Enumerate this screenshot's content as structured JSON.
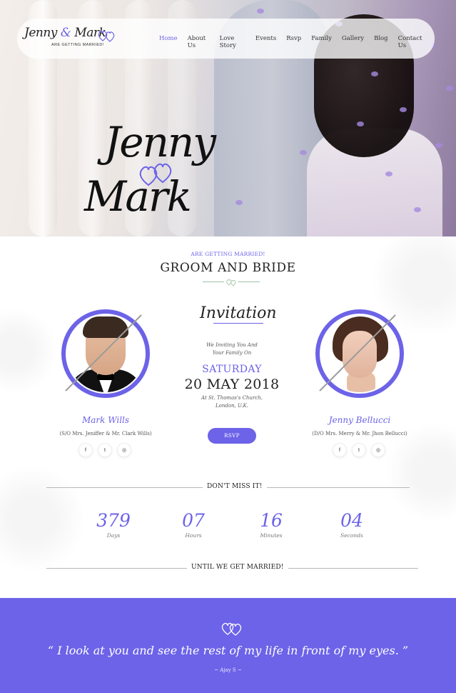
{
  "brand": {
    "logo_names_1": "Jenny ",
    "logo_amp": "&",
    "logo_names_2": " Mark",
    "logo_sub": "ARE GETTING MARRIED!"
  },
  "nav": {
    "items": [
      "Home",
      "About Us",
      "Love Story",
      "Events",
      "Rsvp",
      "Family",
      "Gallery",
      "Blog",
      "Contact Us"
    ],
    "active": "Home"
  },
  "hero": {
    "name_1": "Jenny",
    "name_2": "Mark"
  },
  "couple_section": {
    "eyebrow": "ARE GETTING MARRIED!",
    "title": "GROOM AND BRIDE",
    "groom": {
      "name": "Mark Wills",
      "parents": "(S/O Mrs. Jeniffer & Mr. Clark Wills)"
    },
    "bride": {
      "name": "Jenny Bellucci",
      "parents": "(D/O Mrs. Merry & Mr. Jhon Bellucci)"
    },
    "invitation": {
      "title": "Invitation",
      "line_1": "We Inviting You And",
      "line_2": "Your Family On",
      "day": "SATURDAY",
      "date": "20 MAY 2018",
      "venue_1": "At St. Thomas's Church,",
      "venue_2": "London, U.K.",
      "rsvp_label": "RSVP"
    },
    "social_icons": [
      "facebook-icon",
      "twitter-icon",
      "instagram-icon"
    ],
    "social_glyphs": [
      "f",
      "t",
      "◎"
    ]
  },
  "countdown": {
    "top_label": "DON'T MISS IT!",
    "bottom_label": "UNTIL WE GET MARRIED!",
    "units": [
      {
        "value": "379",
        "label": "Days"
      },
      {
        "value": "07",
        "label": "Hours"
      },
      {
        "value": "16",
        "label": "Minutes"
      },
      {
        "value": "04",
        "label": "Seconds"
      }
    ]
  },
  "quote": {
    "text": "“ I look at you and see the rest of my life in front of my eyes. ”",
    "author": "~ Ajay S ~"
  },
  "colors": {
    "accent": "#6c63e8"
  }
}
